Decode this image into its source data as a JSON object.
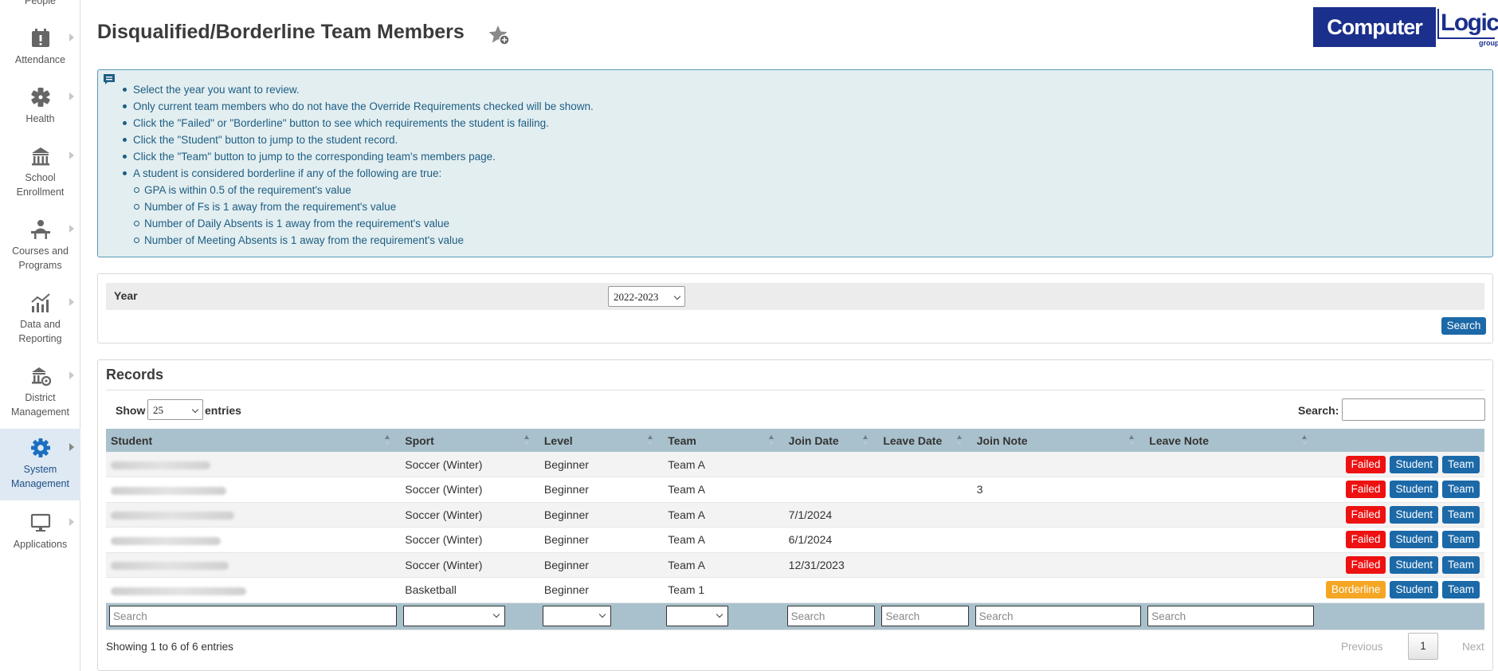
{
  "sidebar": {
    "items": [
      {
        "label": "People",
        "icon": "people-icon"
      },
      {
        "label": "Attendance",
        "icon": "attendance-icon"
      },
      {
        "label": "Health",
        "icon": "health-icon"
      },
      {
        "label": "School Enrollment",
        "icon": "school-icon"
      },
      {
        "label": "Courses and Programs",
        "icon": "courses-icon"
      },
      {
        "label": "Data and Reporting",
        "icon": "chart-icon"
      },
      {
        "label": "District Management",
        "icon": "district-icon"
      },
      {
        "label": "System Management",
        "icon": "gear-icon",
        "active": true
      },
      {
        "label": "Applications",
        "icon": "monitor-icon"
      }
    ]
  },
  "header": {
    "title": "Disqualified/Borderline Team Members",
    "favorite_icon": "star-add-icon",
    "logo": {
      "left": "Computer",
      "right": "Logic",
      "sub": "group"
    }
  },
  "info": {
    "items": [
      "Select the year you want to review.",
      "Only current team members who do not have the Override Requirements checked will be shown.",
      "Click the \"Failed\" or \"Borderline\" button to see which requirements the student is failing.",
      "Click the \"Student\" button to jump to the student record.",
      "Click the \"Team\" button to jump to the corresponding team's members page.",
      "A student is considered borderline if any of the following are true:"
    ],
    "subitems": [
      "GPA is within 0.5 of the requirement's value",
      "Number of Fs is 1 away from the requirement's value",
      "Number of Daily Absents is 1 away from the requirement's value",
      "Number of Meeting Absents is 1 away from the requirement's value"
    ]
  },
  "filter": {
    "year_label": "Year",
    "year_value": "2022-2023",
    "search_label": "Search"
  },
  "records": {
    "title": "Records",
    "show_label": "Show",
    "entries_value": "25",
    "entries_label": "entries",
    "search_label": "Search:",
    "columns": [
      "Student",
      "Sport",
      "Level",
      "Team",
      "Join Date",
      "Leave Date",
      "Join Note",
      "Leave Note"
    ],
    "rows": [
      {
        "sport": "Soccer (Winter)",
        "level": "Beginner",
        "team": "Team A",
        "join_date": "",
        "leave_date": "",
        "join_note": "",
        "leave_note": "",
        "status": "Failed"
      },
      {
        "sport": "Soccer (Winter)",
        "level": "Beginner",
        "team": "Team A",
        "join_date": "",
        "leave_date": "",
        "join_note": "3",
        "leave_note": "",
        "status": "Failed"
      },
      {
        "sport": "Soccer (Winter)",
        "level": "Beginner",
        "team": "Team A",
        "join_date": "7/1/2024",
        "leave_date": "",
        "join_note": "",
        "leave_note": "",
        "status": "Failed"
      },
      {
        "sport": "Soccer (Winter)",
        "level": "Beginner",
        "team": "Team A",
        "join_date": "6/1/2024",
        "leave_date": "",
        "join_note": "",
        "leave_note": "",
        "status": "Failed"
      },
      {
        "sport": "Soccer (Winter)",
        "level": "Beginner",
        "team": "Team A",
        "join_date": "12/31/2023",
        "leave_date": "",
        "join_note": "",
        "leave_note": "",
        "status": "Failed"
      },
      {
        "sport": "Basketball",
        "level": "Beginner",
        "team": "Team 1",
        "join_date": "",
        "leave_date": "",
        "join_note": "",
        "leave_note": "",
        "status": "Borderline"
      }
    ],
    "student_button": "Student",
    "team_button": "Team",
    "filter_placeholder": "Search",
    "showing_text": "Showing 1 to 6 of 6 entries",
    "pagination": {
      "previous": "Previous",
      "page": "1",
      "next": "Next"
    }
  },
  "colors": {
    "failed": "#ee1111",
    "borderline": "#f5a623",
    "primary": "#1c69a8",
    "info_bg": "#e3eef1",
    "table_header": "#a9c1cc"
  }
}
